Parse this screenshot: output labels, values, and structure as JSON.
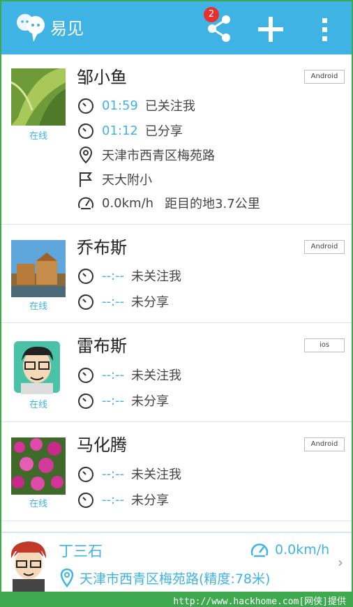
{
  "app": {
    "title": "易见",
    "notification_count": "2",
    "icons": [
      "app-logo-icon",
      "share-icon",
      "plus-icon",
      "overflow-menu-icon"
    ]
  },
  "contacts": [
    {
      "name": "邹小鱼",
      "platform": "Android",
      "status": "在线",
      "follow_time": "01:59",
      "follow_text": "已关注我",
      "share_time": "01:12",
      "share_text": "已分享",
      "location": "天津市西青区梅苑路",
      "destination": "天大附小",
      "speed": "0.0km/h",
      "distance": "距目的地3.7公里"
    },
    {
      "name": "乔布斯",
      "platform": "Android",
      "status": "在线",
      "follow_time": "--:--",
      "follow_text": "未关注我",
      "share_time": "--:--",
      "share_text": "未分享"
    },
    {
      "name": "雷布斯",
      "platform": "ios",
      "status": "在线",
      "follow_time": "--:--",
      "follow_text": "未关注我",
      "share_time": "--:--",
      "share_text": "未分享"
    },
    {
      "name": "马化腾",
      "platform": "Android",
      "status": "在线",
      "follow_time": "--:--",
      "follow_text": "未关注我",
      "share_time": "--:--",
      "share_text": "未分享"
    }
  ],
  "self": {
    "name": "丁三石",
    "speed": "0.0km/h",
    "location": "天津市西青区梅苑路(精度:78米)"
  },
  "watermark": "http://www.hackhome.com[网侠]提供",
  "colors": {
    "accent": "#3fb3e4",
    "badge": "#e8312f",
    "watermark_bar": "#3ea94f"
  }
}
